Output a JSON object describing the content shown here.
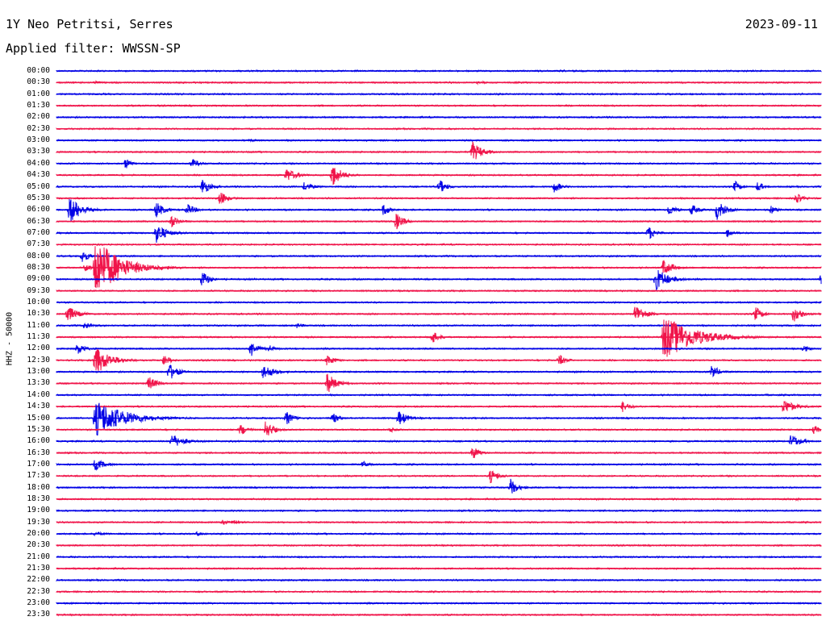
{
  "header": {
    "station": "1Y Neo Petritsi, Serres",
    "date": "2023-09-11",
    "filter": "Applied filter: WWSSN-SP"
  },
  "chart_data": {
    "type": "line",
    "title": "1Y Neo Petritsi, Serres",
    "ylabel": "HHZ - 50000",
    "colors": [
      "#0000e6",
      "#f0144a"
    ],
    "grid": false,
    "rows": [
      {
        "label": "00:00"
      },
      {
        "label": "00:30"
      },
      {
        "label": "01:00"
      },
      {
        "label": "01:30"
      },
      {
        "label": "02:00"
      },
      {
        "label": "02:30"
      },
      {
        "label": "03:00"
      },
      {
        "label": "03:30"
      },
      {
        "label": "04:00"
      },
      {
        "label": "04:30"
      },
      {
        "label": "05:00"
      },
      {
        "label": "05:30"
      },
      {
        "label": "06:00"
      },
      {
        "label": "06:30"
      },
      {
        "label": "07:00"
      },
      {
        "label": "07:30"
      },
      {
        "label": "08:00"
      },
      {
        "label": "08:30"
      },
      {
        "label": "09:00"
      },
      {
        "label": "09:30"
      },
      {
        "label": "10:00"
      },
      {
        "label": "10:30"
      },
      {
        "label": "11:00"
      },
      {
        "label": "11:30"
      },
      {
        "label": "12:00"
      },
      {
        "label": "12:30"
      },
      {
        "label": "13:00"
      },
      {
        "label": "13:30"
      },
      {
        "label": "14:00"
      },
      {
        "label": "14:30"
      },
      {
        "label": "15:00"
      },
      {
        "label": "15:30"
      },
      {
        "label": "16:00"
      },
      {
        "label": "16:30"
      },
      {
        "label": "17:00"
      },
      {
        "label": "17:30"
      },
      {
        "label": "18:00"
      },
      {
        "label": "18:30"
      },
      {
        "label": "19:00"
      },
      {
        "label": "19:30"
      },
      {
        "label": "20:00"
      },
      {
        "label": "20:30"
      },
      {
        "label": "21:00"
      },
      {
        "label": "21:30"
      },
      {
        "label": "22:00"
      },
      {
        "label": "22:30"
      },
      {
        "label": "23:00"
      },
      {
        "label": "23:30"
      }
    ],
    "events": [
      {
        "row": 1,
        "minute": 1.5,
        "amp": 2,
        "dur": 1.0
      },
      {
        "row": 1,
        "minute": 16.5,
        "amp": 2,
        "dur": 1.0
      },
      {
        "row": 3,
        "minute": 25.0,
        "amp": 1.5,
        "dur": 2.0
      },
      {
        "row": 6,
        "minute": 7.5,
        "amp": 1.5,
        "dur": 1.5
      },
      {
        "row": 7,
        "minute": 16.3,
        "amp": 14,
        "dur": 0.8
      },
      {
        "row": 8,
        "minute": 2.7,
        "amp": 8,
        "dur": 0.5
      },
      {
        "row": 8,
        "minute": 5.3,
        "amp": 6,
        "dur": 0.7
      },
      {
        "row": 9,
        "minute": 9.0,
        "amp": 10,
        "dur": 0.8
      },
      {
        "row": 9,
        "minute": 10.8,
        "amp": 16,
        "dur": 0.8
      },
      {
        "row": 10,
        "minute": 5.7,
        "amp": 12,
        "dur": 0.6
      },
      {
        "row": 10,
        "minute": 9.7,
        "amp": 6,
        "dur": 0.8
      },
      {
        "row": 10,
        "minute": 15.0,
        "amp": 10,
        "dur": 0.6
      },
      {
        "row": 10,
        "minute": 19.5,
        "amp": 8,
        "dur": 0.6
      },
      {
        "row": 10,
        "minute": 26.6,
        "amp": 8,
        "dur": 0.5
      },
      {
        "row": 10,
        "minute": 27.5,
        "amp": 8,
        "dur": 0.5
      },
      {
        "row": 11,
        "minute": 6.4,
        "amp": 10,
        "dur": 0.6
      },
      {
        "row": 11,
        "minute": 29.0,
        "amp": 8,
        "dur": 0.6
      },
      {
        "row": 12,
        "minute": 0.5,
        "amp": 18,
        "dur": 1.0
      },
      {
        "row": 12,
        "minute": 3.9,
        "amp": 12,
        "dur": 0.6
      },
      {
        "row": 12,
        "minute": 5.1,
        "amp": 8,
        "dur": 0.7
      },
      {
        "row": 12,
        "minute": 12.8,
        "amp": 8,
        "dur": 0.6
      },
      {
        "row": 12,
        "minute": 24.0,
        "amp": 8,
        "dur": 0.6
      },
      {
        "row": 12,
        "minute": 24.9,
        "amp": 8,
        "dur": 0.6
      },
      {
        "row": 12,
        "minute": 25.9,
        "amp": 14,
        "dur": 0.7
      },
      {
        "row": 12,
        "minute": 28.0,
        "amp": 6,
        "dur": 0.6
      },
      {
        "row": 13,
        "minute": 4.5,
        "amp": 8,
        "dur": 0.7
      },
      {
        "row": 13,
        "minute": 13.3,
        "amp": 12,
        "dur": 0.6
      },
      {
        "row": 14,
        "minute": 3.9,
        "amp": 14,
        "dur": 0.8
      },
      {
        "row": 14,
        "minute": 23.2,
        "amp": 10,
        "dur": 0.6
      },
      {
        "row": 14,
        "minute": 26.3,
        "amp": 6,
        "dur": 0.6
      },
      {
        "row": 16,
        "minute": 1.0,
        "amp": 10,
        "dur": 0.5
      },
      {
        "row": 17,
        "minute": 1.1,
        "amp": 6,
        "dur": 0.6
      },
      {
        "row": 17,
        "minute": 1.5,
        "amp": 40,
        "dur": 2.0
      },
      {
        "row": 17,
        "minute": 23.8,
        "amp": 12,
        "dur": 0.8
      },
      {
        "row": 18,
        "minute": 5.7,
        "amp": 12,
        "dur": 0.6
      },
      {
        "row": 18,
        "minute": 23.5,
        "amp": 16,
        "dur": 1.0
      },
      {
        "row": 18,
        "minute": 30.0,
        "amp": 10,
        "dur": 0.6
      },
      {
        "row": 21,
        "minute": 0.4,
        "amp": 12,
        "dur": 0.8
      },
      {
        "row": 21,
        "minute": 22.7,
        "amp": 14,
        "dur": 0.8
      },
      {
        "row": 21,
        "minute": 27.4,
        "amp": 10,
        "dur": 0.6
      },
      {
        "row": 21,
        "minute": 28.9,
        "amp": 12,
        "dur": 0.6
      },
      {
        "row": 22,
        "minute": 1.1,
        "amp": 6,
        "dur": 0.6
      },
      {
        "row": 22,
        "minute": 9.4,
        "amp": 4,
        "dur": 0.6
      },
      {
        "row": 23,
        "minute": 14.7,
        "amp": 10,
        "dur": 0.6
      },
      {
        "row": 23,
        "minute": 23.8,
        "amp": 30,
        "dur": 2.5
      },
      {
        "row": 24,
        "minute": 0.8,
        "amp": 8,
        "dur": 0.7
      },
      {
        "row": 24,
        "minute": 7.6,
        "amp": 12,
        "dur": 0.6
      },
      {
        "row": 24,
        "minute": 8.3,
        "amp": 6,
        "dur": 0.6
      },
      {
        "row": 24,
        "minute": 29.3,
        "amp": 5,
        "dur": 0.5
      },
      {
        "row": 25,
        "minute": 1.5,
        "amp": 20,
        "dur": 1.2
      },
      {
        "row": 25,
        "minute": 4.2,
        "amp": 8,
        "dur": 0.6
      },
      {
        "row": 25,
        "minute": 10.6,
        "amp": 8,
        "dur": 0.6
      },
      {
        "row": 25,
        "minute": 19.7,
        "amp": 8,
        "dur": 0.6
      },
      {
        "row": 26,
        "minute": 4.4,
        "amp": 12,
        "dur": 0.7
      },
      {
        "row": 26,
        "minute": 8.1,
        "amp": 10,
        "dur": 1.0
      },
      {
        "row": 26,
        "minute": 25.7,
        "amp": 10,
        "dur": 0.6
      },
      {
        "row": 27,
        "minute": 3.6,
        "amp": 10,
        "dur": 0.7
      },
      {
        "row": 27,
        "minute": 10.6,
        "amp": 14,
        "dur": 0.8
      },
      {
        "row": 29,
        "minute": 22.2,
        "amp": 8,
        "dur": 0.6
      },
      {
        "row": 29,
        "minute": 28.5,
        "amp": 10,
        "dur": 1.0
      },
      {
        "row": 30,
        "minute": 1.5,
        "amp": 24,
        "dur": 2.5
      },
      {
        "row": 30,
        "minute": 9.0,
        "amp": 10,
        "dur": 0.6
      },
      {
        "row": 30,
        "minute": 10.8,
        "amp": 8,
        "dur": 0.6
      },
      {
        "row": 30,
        "minute": 13.4,
        "amp": 10,
        "dur": 0.8
      },
      {
        "row": 31,
        "minute": 7.2,
        "amp": 8,
        "dur": 0.6
      },
      {
        "row": 31,
        "minute": 8.2,
        "amp": 14,
        "dur": 0.6
      },
      {
        "row": 31,
        "minute": 13.1,
        "amp": 4,
        "dur": 0.6
      },
      {
        "row": 31,
        "minute": 29.7,
        "amp": 6,
        "dur": 0.6
      },
      {
        "row": 32,
        "minute": 4.5,
        "amp": 10,
        "dur": 1.0
      },
      {
        "row": 32,
        "minute": 28.8,
        "amp": 10,
        "dur": 0.8
      },
      {
        "row": 33,
        "minute": 16.3,
        "amp": 10,
        "dur": 0.6
      },
      {
        "row": 34,
        "minute": 1.5,
        "amp": 8,
        "dur": 0.8
      },
      {
        "row": 34,
        "minute": 12.0,
        "amp": 4,
        "dur": 0.6
      },
      {
        "row": 35,
        "minute": 17.0,
        "amp": 10,
        "dur": 0.6
      },
      {
        "row": 36,
        "minute": 17.8,
        "amp": 12,
        "dur": 0.6
      },
      {
        "row": 37,
        "minute": 29.0,
        "amp": 3,
        "dur": 0.5
      },
      {
        "row": 39,
        "minute": 6.5,
        "amp": 4,
        "dur": 0.6
      },
      {
        "row": 39,
        "minute": 6.9,
        "amp": 4,
        "dur": 0.6
      },
      {
        "row": 40,
        "minute": 1.5,
        "amp": 3,
        "dur": 1.0
      },
      {
        "row": 40,
        "minute": 5.5,
        "amp": 3,
        "dur": 0.5
      }
    ]
  }
}
